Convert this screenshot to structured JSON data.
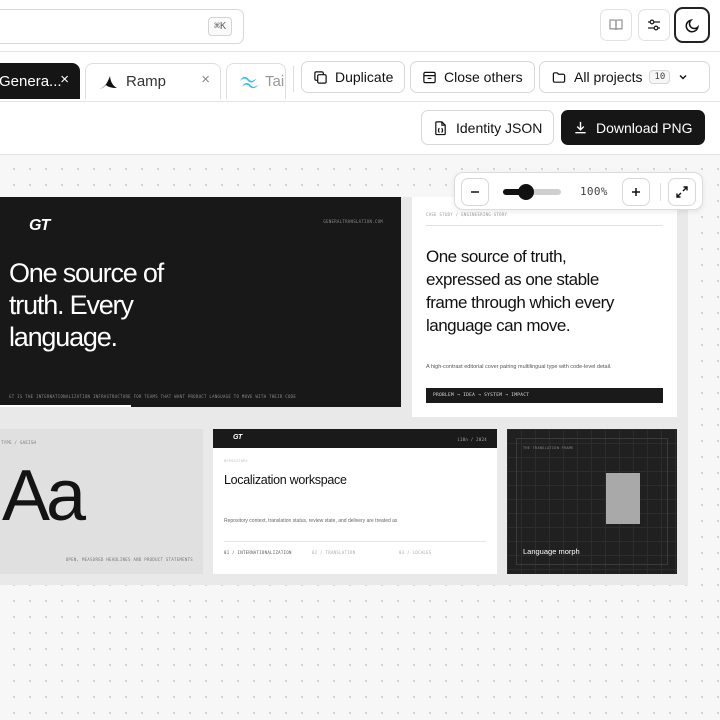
{
  "search": {
    "shortcut": "⌘K"
  },
  "header_icons": [
    "book-icon",
    "sliders-icon",
    "moon-icon"
  ],
  "tabs": [
    {
      "label": "Genera...",
      "close": "×",
      "active": true
    },
    {
      "label": "Ramp",
      "close": "×",
      "active": false
    },
    {
      "label": "Tai",
      "active": false
    }
  ],
  "toolbar": {
    "duplicate": "Duplicate",
    "close_others": "Close others",
    "all_projects": "All projects",
    "project_count": "10"
  },
  "actions": {
    "identity_json": "Identity JSON",
    "download_png": "Download PNG"
  },
  "zoom": {
    "level_text": "100%",
    "level": 0.4
  },
  "frames": {
    "hero": {
      "logo": "GT",
      "url": "GENERALTRANSLATION.COM",
      "headline_1": "One source of",
      "headline_2": "truth. Every",
      "headline_3": "language.",
      "footer": "GT IS THE INTERNATIONALIZATION INFRASTRUCTURE FOR TEAMS THAT WANT PRODUCT LANGUAGE TO MOVE WITH THEIR CODE"
    },
    "case_study": {
      "label": "CASE STUDY / ENGINEERING STORY",
      "headline_1": "One source of truth,",
      "headline_2": "expressed as one stable",
      "headline_3": "frame through which every",
      "headline_4": "language can move.",
      "description": "A high-contrast editorial cover pairing multilingual type with code-level detail.",
      "tags": "PROBLEM → IDEA → SYSTEM → IMPACT"
    },
    "type": {
      "label": "TYPE / GAEISH",
      "specimen": "Aa",
      "caption": "OPEN, MEASURED HEADLINES AND PRODUCT STATEMENTS"
    },
    "workspace": {
      "logo": "GT",
      "meta": "i18n / 2024",
      "sub": "REPOSITORY",
      "title": "Localization workspace",
      "description": "Repository context, translation status, review state, and delivery are treated as",
      "cols": [
        "01 / INTERNATIONALIZATION",
        "02 / TRANSLATION",
        "03 / LOCALES"
      ]
    },
    "morph": {
      "label": "THE TRANSLATION FRAME",
      "title": "Language morph"
    }
  }
}
